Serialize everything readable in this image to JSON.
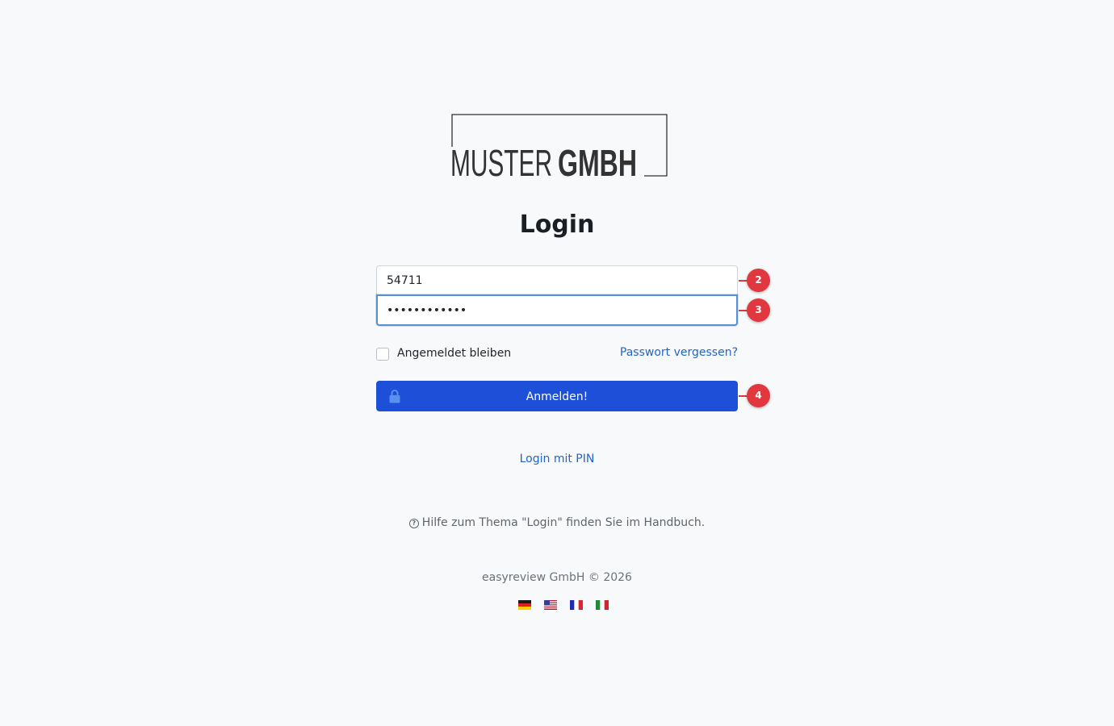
{
  "logo": {
    "light_text": "MUSTER",
    "bold_text": "GMBH"
  },
  "title": "Login",
  "form": {
    "username_value": "54711",
    "password_value": "••••••••••••",
    "remember_label": "Angemeldet bleiben",
    "forgot_label": "Passwort vergessen?",
    "submit_label": "Anmelden!"
  },
  "annotations": [
    "2",
    "3",
    "4"
  ],
  "pin_link": "Login mit PIN",
  "help_text": "Hilfe zum Thema \"Login\" finden Sie im Handbuch.",
  "copyright": "easyreview GmbH © 2026",
  "languages": [
    {
      "code": "de",
      "icon": "flag-germany-icon"
    },
    {
      "code": "us",
      "icon": "flag-usa-icon"
    },
    {
      "code": "fr",
      "icon": "flag-france-icon"
    },
    {
      "code": "it",
      "icon": "flag-italy-icon"
    }
  ],
  "colors": {
    "background": "#f8f9fb",
    "primary": "#1d4fd8",
    "link": "#2264c9",
    "badge": "#e0383e",
    "focus_border": "#5b8fd3"
  }
}
